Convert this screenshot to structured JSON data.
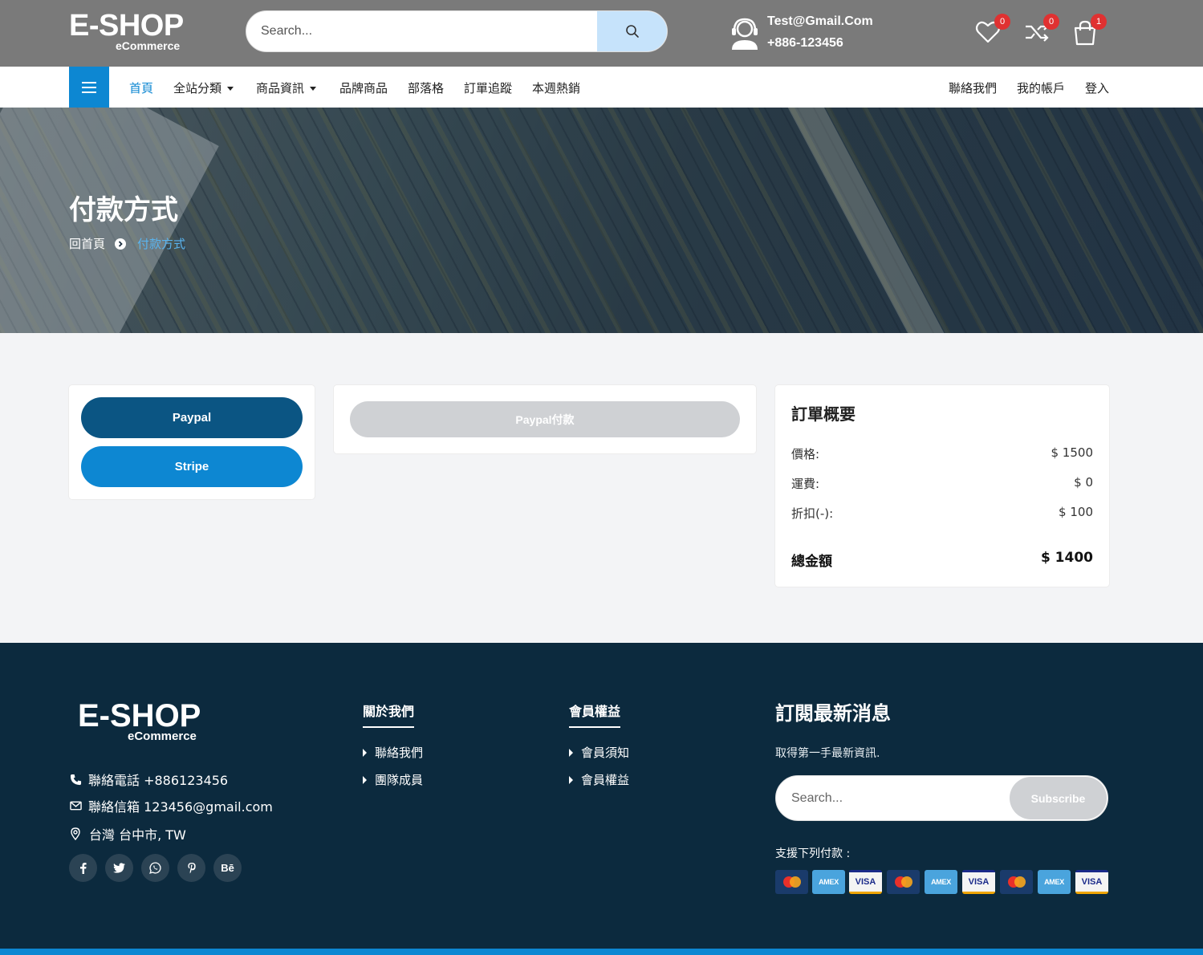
{
  "header": {
    "logo_main": "E-SHOP",
    "logo_sub": "eCommerce",
    "search_placeholder": "Search...",
    "contact_email": "Test@Gmail.Com",
    "contact_phone": "+886-123456",
    "wishlist_count": "0",
    "compare_count": "0",
    "cart_count": "1"
  },
  "nav": {
    "items": [
      "首頁",
      "全站分類",
      "商品資訊",
      "品牌商品",
      "部落格",
      "訂單追蹤",
      "本週熱銷"
    ],
    "right_items": [
      "聯絡我們",
      "我的帳戶",
      "登入"
    ]
  },
  "hero": {
    "title": "付款方式",
    "breadcrumb_home": "回首頁",
    "breadcrumb_current": "付款方式"
  },
  "payment_methods": {
    "paypal_label": "Paypal",
    "stripe_label": "Stripe",
    "paypal_pay_button": "Paypal付款"
  },
  "order_summary": {
    "title": "訂單概要",
    "rows": [
      {
        "label": "價格:",
        "value": "$ 1500"
      },
      {
        "label": "運費:",
        "value": "$ 0"
      },
      {
        "label": "折扣(-):",
        "value": "$ 100"
      }
    ],
    "total_label": "總金額",
    "total_value": "$ 1400"
  },
  "footer": {
    "logo_main": "E-SHOP",
    "logo_sub": "eCommerce",
    "phone": "聯絡電話 +886123456",
    "email": "聯絡信箱 123456@gmail.com",
    "address": "台灣 台中市, TW",
    "socials": [
      "facebook",
      "twitter",
      "whatsapp",
      "pinterest",
      "behance"
    ],
    "behance_text": "Bē",
    "about_heading": "關於我們",
    "about_links": [
      "聯絡我們",
      "團隊成員"
    ],
    "member_heading": "會員權益",
    "member_links": [
      "會員須知",
      "會員權益"
    ],
    "subscribe_heading": "訂閱最新消息",
    "subscribe_text": "取得第一手最新資訊.",
    "subscribe_placeholder": "Search...",
    "subscribe_button": "Subscribe",
    "payments_label": "支援下列付款 :",
    "payment_cards": [
      "MasterCard",
      "AMEX",
      "VISA",
      "MasterCard",
      "AMEX",
      "VISA",
      "MasterCard",
      "AMEX",
      "VISA"
    ],
    "amex_text": "AMEX",
    "visa_text": "VISA"
  },
  "colors": {
    "header_bg": "#7a7a7a",
    "accent": "#0d87d2",
    "paypal_button": "#0b5583",
    "footer_bg": "#0c2a3e",
    "badge": "#e03131"
  }
}
